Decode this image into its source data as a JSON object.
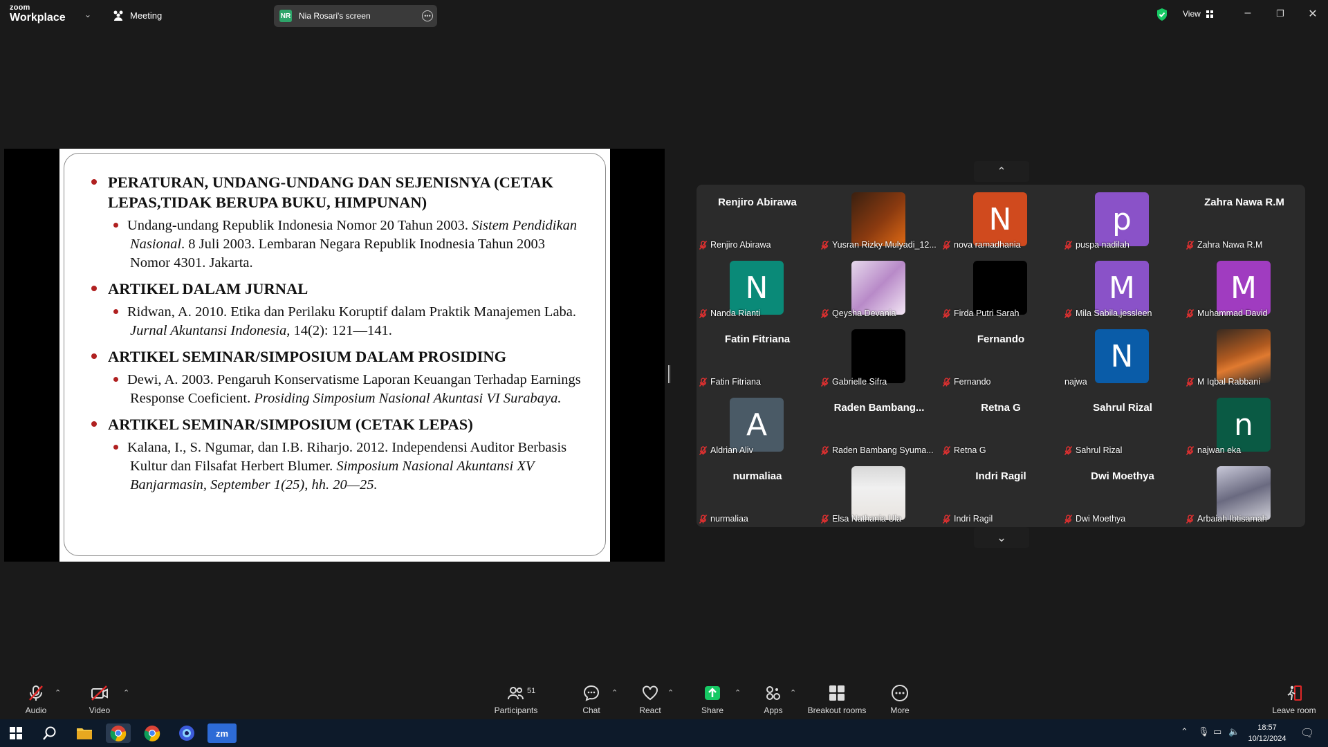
{
  "app": {
    "logo_line1": "zoom",
    "logo_line2": "Workplace",
    "meeting_label": "Meeting",
    "share_badge": "NR",
    "share_title": "Nia Rosari's screen",
    "view_label": "View"
  },
  "slide": {
    "sections": [
      {
        "heading": "PERATURAN, UNDANG-UNDANG DAN SEJENISNYA (CETAK LEPAS,TIDAK BERUPA BUKU, HIMPUNAN)",
        "item_plain": "Undang-undang Republik Indonesia Nomor 20 Tahun 2003. ",
        "item_italic": "Sistem Pendidikan Nasional",
        "item_tail": ". 8 Juli 2003. Lembaran Negara Republik Inodnesia Tahun 2003 Nomor 4301. Jakarta."
      },
      {
        "heading": "ARTIKEL DALAM JURNAL",
        "item_plain": "Ridwan, A. 2010. Etika dan Perilaku Koruptif dalam Praktik Manajemen Laba. ",
        "item_italic": "Jurnal Akuntansi Indonesia,",
        "item_tail": " 14(2): 121—141."
      },
      {
        "heading": "ARTIKEL SEMINAR/SIMPOSIUM DALAM PROSIDING",
        "item_plain": "Dewi,  A. 2003. Pengaruh Konservatisme Laporan Keuangan Terhadap Earnings Response Coeficient. ",
        "item_italic": "Prosiding Simposium Nasional Akuntasi VI Surabaya.",
        "item_tail": ""
      },
      {
        "heading": "ARTIKEL SEMINAR/SIMPOSIUM (CETAK LEPAS)",
        "item_plain": "Kalana, I., S. Ngumar, dan I.B. Riharjo. 2012. Independensi Auditor Berbasis Kultur dan Filsafat Herbert Blumer.  ",
        "item_italic": "Simposium Nasional Akuntansi XV Banjarmasin, September 1(25),  hh. 20—25.",
        "item_tail": ""
      }
    ]
  },
  "participants": [
    {
      "display": "Renjiro Abirawa",
      "name": "Renjiro Abirawa",
      "muted": true
    },
    {
      "display": "",
      "name": "Yusran Rizky Mulyadi_12...",
      "muted": true,
      "video": "orange"
    },
    {
      "display": "",
      "avatar": "N",
      "avatar_color": "#d04a1e",
      "name": "nova ramadhania",
      "muted": true
    },
    {
      "display": "",
      "avatar": "p",
      "avatar_color": "#8a52c8",
      "name": "puspa nadilah",
      "muted": true
    },
    {
      "display": "Zahra Nawa R.M",
      "name": "Zahra Nawa R.M",
      "muted": true
    },
    {
      "display": "",
      "avatar": "N",
      "avatar_color": "#0a8a78",
      "name": "Nanda Rianti",
      "muted": true
    },
    {
      "display": "",
      "name": "Qeysha Devania",
      "muted": true,
      "video": "pink"
    },
    {
      "display": "",
      "name": "Firda Putri Sarah",
      "muted": true,
      "video": "black"
    },
    {
      "display": "",
      "avatar": "M",
      "avatar_color": "#8a52c8",
      "name": "Mila Sabila,jessleen",
      "muted": true
    },
    {
      "display": "",
      "avatar": "M",
      "avatar_color": "#a03cc0",
      "name": "Muhammad David",
      "muted": true
    },
    {
      "display": "Fatin Fitriana",
      "name": "Fatin Fitriana",
      "muted": true
    },
    {
      "display": "",
      "name": "Gabrielle Sifra",
      "muted": true,
      "video": "black"
    },
    {
      "display": "Fernando",
      "name": "Fernando",
      "muted": true
    },
    {
      "display": "",
      "avatar": "N",
      "avatar_color": "#0a5ca8",
      "name": "najwa",
      "muted": false
    },
    {
      "display": "",
      "name": "M Iqbal Rabbani",
      "muted": true,
      "video": "car"
    },
    {
      "display": "",
      "avatar": "A",
      "avatar_color": "#4a5a66",
      "name": "Aldrian Aliv",
      "muted": true
    },
    {
      "display": "Raden  Bambang...",
      "name": "Raden Bambang Syuma...",
      "muted": true
    },
    {
      "display": "Retna G",
      "name": "Retna G",
      "muted": true
    },
    {
      "display": "Sahrul Rizal",
      "name": "Sahrul Rizal",
      "muted": true
    },
    {
      "display": "",
      "avatar": "n",
      "avatar_color": "#0a5a44",
      "name": "najwan eka",
      "muted": true
    },
    {
      "display": "nurmaliaa",
      "name": "nurmaliaa",
      "muted": true
    },
    {
      "display": "",
      "name": "Elsa Nathania Ula",
      "muted": true,
      "video": "face"
    },
    {
      "display": "Indri Ragil",
      "name": "Indri Ragil",
      "muted": true
    },
    {
      "display": "Dwi Moethya",
      "name": "Dwi Moethya",
      "muted": true
    },
    {
      "display": "",
      "name": "Arbaiah Ibtisamah",
      "muted": true,
      "video": "cat"
    }
  ],
  "toolbar": {
    "audio": "Audio",
    "video": "Video",
    "participants": "Participants",
    "participants_count": "51",
    "chat": "Chat",
    "react": "React",
    "share": "Share",
    "apps": "Apps",
    "breakout": "Breakout rooms",
    "more": "More",
    "leave": "Leave room"
  },
  "taskbar": {
    "time": "18:57",
    "date": "10/12/2024",
    "zoom_icon_text": "zm"
  },
  "colors": {
    "share_green": "#17c964",
    "bullet_red": "#b02020",
    "leave_red": "#e02828"
  }
}
